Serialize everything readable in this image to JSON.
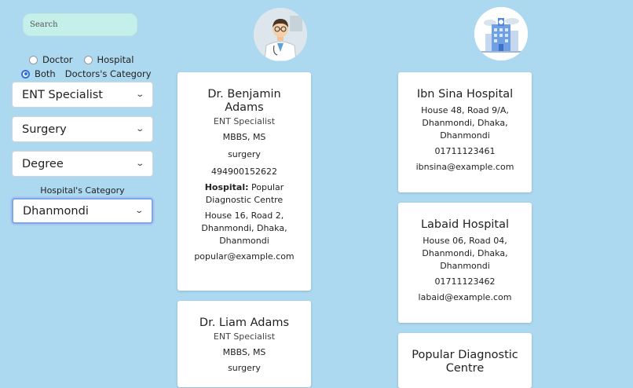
{
  "search": {
    "placeholder": "Search"
  },
  "filters": {
    "radios": [
      {
        "label": "Doctor",
        "checked": false
      },
      {
        "label": "Hospital",
        "checked": false
      },
      {
        "label": "Both",
        "checked": true
      }
    ],
    "doctors_category_label": "Doctors's Category",
    "specialist_select": "ENT Specialist",
    "treatment_select": "Surgery",
    "degree_select": "Degree",
    "hospital_category_label": "Hospital's Category",
    "area_select": "Dhanmondi"
  },
  "icons": {
    "doctor_avatar": "doctor-avatar-icon",
    "hospital_avatar": "hospital-building-icon",
    "dropdown": "chevron-down-icon"
  },
  "doctors": [
    {
      "name": "Dr. Benjamin Adams",
      "specialty": "ENT Specialist",
      "degree": "MBBS, MS",
      "treatment": "surgery",
      "phone": "494900152622",
      "hospital_label": "Hospital:",
      "hospital": "Popular Diagnostic Centre",
      "address": "House 16, Road 2, Dhanmondi, Dhaka, Dhanmondi",
      "email": "popular@example.com"
    },
    {
      "name": "Dr. Liam Adams",
      "specialty": "ENT Specialist",
      "degree": "MBBS, MS",
      "treatment": "surgery"
    }
  ],
  "hospitals": [
    {
      "name": "Ibn Sina Hospital",
      "address": "House 48, Road 9/A, Dhanmondi, Dhaka, Dhanmondi",
      "phone": "01711123461",
      "email": "ibnsina@example.com"
    },
    {
      "name": "Labaid Hospital",
      "address": "House 06, Road 04, Dhanmondi, Dhaka, Dhanmondi",
      "phone": "01711123462",
      "email": "labaid@example.com"
    },
    {
      "name": "Popular Diagnostic Centre"
    }
  ],
  "colors": {
    "background": "#acd8f0",
    "search_bg": "#c5f0ea",
    "radio_accent": "#2f6fe0",
    "card_bg": "#ffffff"
  }
}
